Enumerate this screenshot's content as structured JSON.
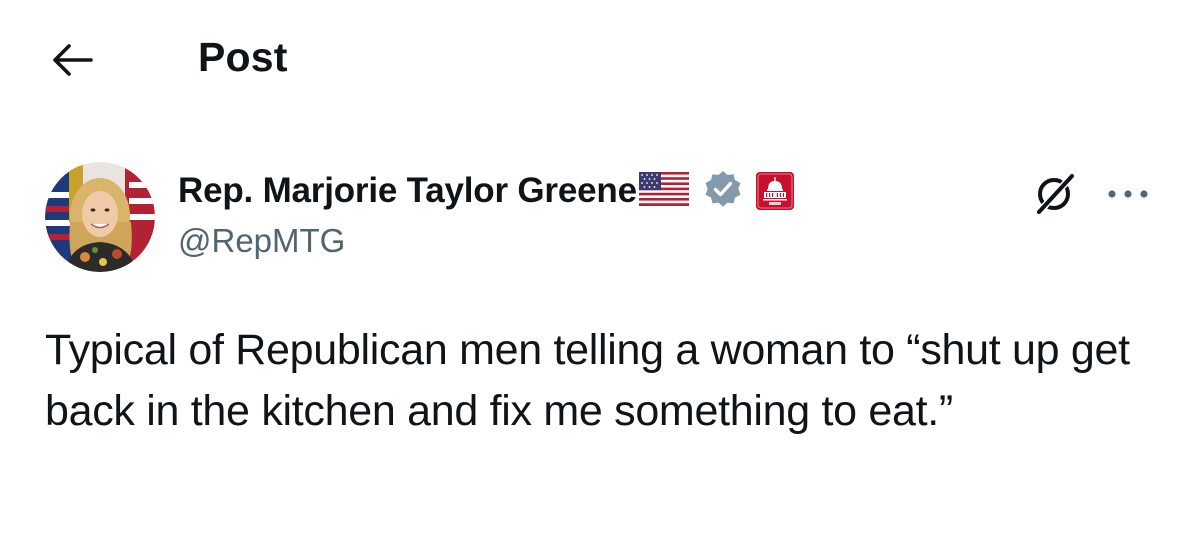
{
  "header": {
    "title": "Post",
    "back_icon": "arrow-left-icon"
  },
  "post": {
    "author": {
      "display_name": "Rep. Marjorie Taylor Greene",
      "handle": "@RepMTG",
      "flag_icon": "us-flag-icon",
      "verified_icon": "verified-badge-icon",
      "verified_color": "#829aab",
      "affiliation_icon": "capitol-building-icon",
      "affiliation_color": "#c8102e"
    },
    "text": "Typical of Republican men telling a woman to “shut up get back in the kitchen and fix me something to eat.”",
    "actions": {
      "grok_icon": "grok-icon",
      "more_icon": "more-horizontal-icon"
    }
  }
}
